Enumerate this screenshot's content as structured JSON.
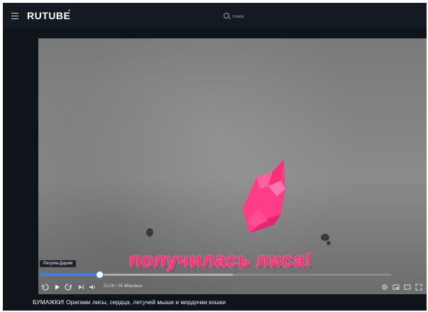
{
  "app": {
    "brand": "RUTUBE"
  },
  "search": {
    "placeholder": "Поиск"
  },
  "video": {
    "subtitle": "получилась лиса!",
    "tooltip": "Рисуем-Дарим",
    "time_display": "01:06 / 06:15",
    "chapter_label": "• превью",
    "progress": 0.17,
    "buffered": 0.55,
    "title": "БУМАЖКИ! Оригами лисы, сердца, летучей мыши и мордочки кошки"
  },
  "icons": {
    "menu": "menu-icon",
    "search": "search-icon",
    "replay": "replay-10-icon",
    "play": "play-icon",
    "forward": "forward-10-icon",
    "next": "next-icon",
    "volume": "volume-icon",
    "settings": "settings-icon",
    "miniplayer": "miniplayer-icon",
    "theater": "theater-icon",
    "fullscreen": "fullscreen-icon"
  },
  "colors": {
    "background": "#0f141b",
    "accent_progress": "#2f84ff",
    "subtitle": "#ff2f7a"
  }
}
